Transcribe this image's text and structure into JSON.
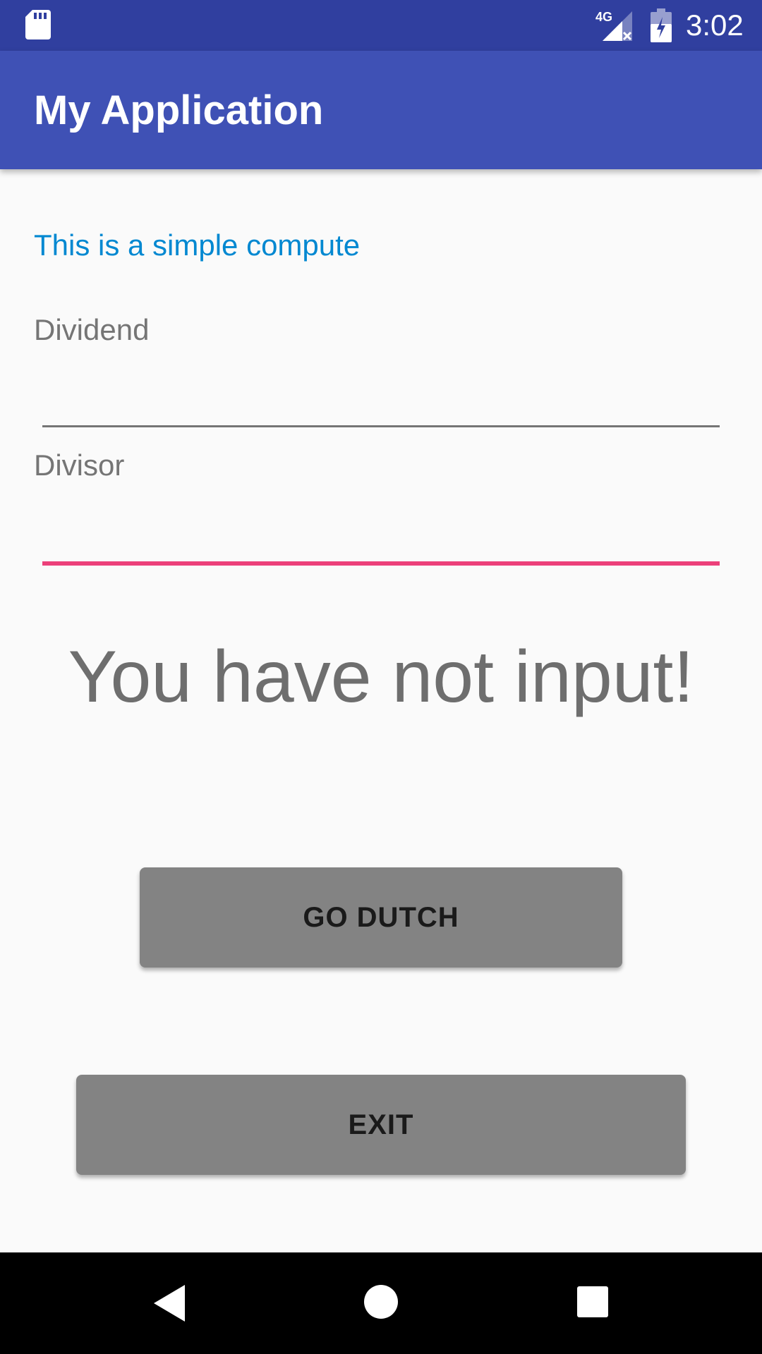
{
  "status_bar": {
    "time": "3:02",
    "network_label": "4G",
    "icons": [
      "sd-card-icon",
      "cellular-signal-icon",
      "battery-charging-icon"
    ]
  },
  "app_bar": {
    "title": "My Application"
  },
  "form": {
    "intro": "This is a simple compute",
    "dividend": {
      "label": "Dividend",
      "value": ""
    },
    "divisor": {
      "label": "Divisor",
      "value": ""
    }
  },
  "result": {
    "message": "You have not input!"
  },
  "buttons": {
    "go_dutch": "GO DUTCH",
    "exit": "EXIT"
  },
  "nav_bar": {
    "icons": [
      "back-icon",
      "home-icon",
      "recent-apps-icon"
    ]
  },
  "colors": {
    "status_bar": "#303f9f",
    "app_bar": "#3f51b5",
    "intro_text": "#0288d1",
    "focused_line": "#ec407a",
    "button": "#838383"
  }
}
